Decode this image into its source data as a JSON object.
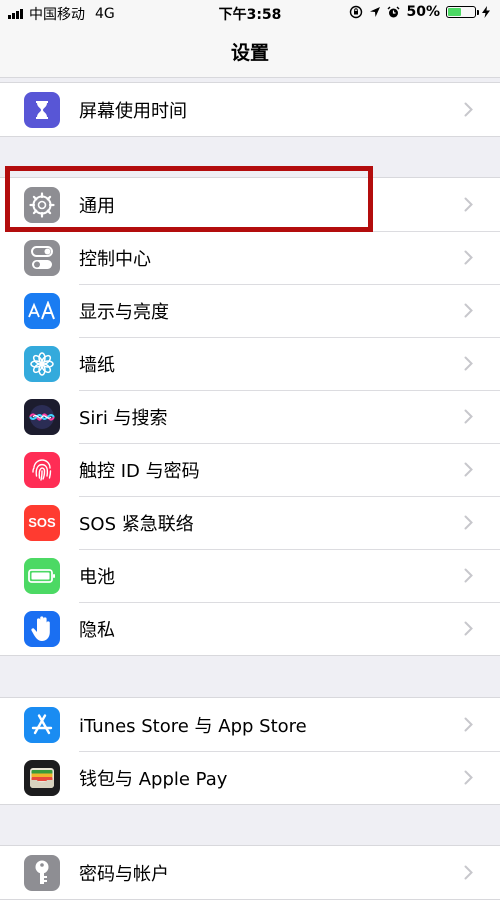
{
  "status_bar": {
    "carrier": "中国移动",
    "network": "4G",
    "time": "下午3:58",
    "battery": "50%",
    "battery_level": 0.5
  },
  "nav": {
    "title": "设置"
  },
  "groups": [
    {
      "items": [
        {
          "label": "屏幕使用时间",
          "icon": "hourglass-icon",
          "color": "#5856d6"
        }
      ]
    },
    {
      "items": [
        {
          "label": "通用",
          "icon": "gear-icon",
          "color": "#8e8e93"
        },
        {
          "label": "控制中心",
          "icon": "toggle-switches-icon",
          "color": "#8e8e93"
        },
        {
          "label": "显示与亮度",
          "icon": "text-size-icon",
          "color": "#1a7cf2"
        },
        {
          "label": "墙纸",
          "icon": "flower-icon",
          "color": "#34aadc"
        },
        {
          "label": "Siri 与搜索",
          "icon": "siri-icon",
          "color": "#1c1c2e"
        },
        {
          "label": "触控 ID 与密码",
          "icon": "fingerprint-icon",
          "color": "#ff2d55"
        },
        {
          "label": "SOS 紧急联络",
          "icon": "sos-icon",
          "color": "#ff3b30",
          "icon_text": "SOS"
        },
        {
          "label": "电池",
          "icon": "battery-icon",
          "color": "#4cd964"
        },
        {
          "label": "隐私",
          "icon": "hand-icon",
          "color": "#1a6ff2"
        }
      ]
    },
    {
      "items": [
        {
          "label": "iTunes Store 与 App Store",
          "icon": "app-store-icon",
          "color": "#1a8cf2"
        },
        {
          "label": "钱包与 Apple Pay",
          "icon": "wallet-icon",
          "color": "#1c1c1e"
        }
      ]
    },
    {
      "items": [
        {
          "label": "密码与帐户",
          "icon": "key-icon",
          "color": "#8e8e93"
        }
      ]
    }
  ]
}
